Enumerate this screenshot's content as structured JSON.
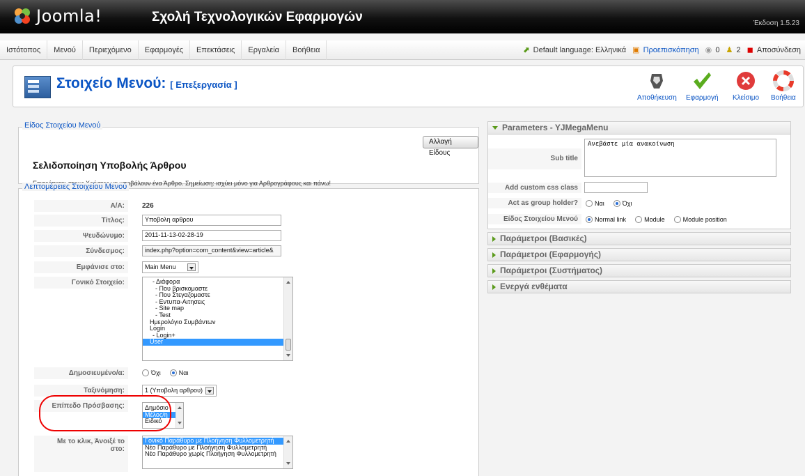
{
  "header": {
    "logo_text": "Joomla!",
    "site_name": "Σχολή Τεχνολογικών Εφαρμογών",
    "version": "Έκδοση 1.5.23"
  },
  "menu": {
    "items": [
      "Ιστότοπος",
      "Μενού",
      "Περιεχόμενο",
      "Εφαρμογές",
      "Επεκτάσεις",
      "Εργαλεία",
      "Βοήθεια"
    ]
  },
  "status": {
    "default_language": "Default language: Ελληνικά",
    "preview": "Προεπισκόπηση",
    "messages": "0",
    "users": "2",
    "logout": "Αποσύνδεση"
  },
  "toolbar": {
    "title": "Στοιχείο Μενού:",
    "subtitle": "[ Επεξεργασία ]",
    "save": "Αποθήκευση",
    "apply": "Εφαρμογή",
    "close": "Κλείσιμο",
    "help": "Βοήθεια"
  },
  "item_type": {
    "legend": "Είδος Στοιχείου Μενού",
    "change_button": "Αλλαγή Είδους",
    "title": "Σελιδοποίηση Υποβολής Άρθρου",
    "description": "Επιτρέπεται στους Χρήστες να υποβάλουν ένα Άρθρο. Σημείωση: ισχύει μόνο για Αρθρογράφους και πάνω!"
  },
  "details": {
    "legend": "Λεπτομέρειες Στοιχείου Μενού",
    "id_label": "Α/Α:",
    "id_value": "226",
    "title_label": "Τίτλος:",
    "title_value": "Υποβολη αρθρου",
    "alias_label": "Ψευδώνυμο:",
    "alias_value": "2011-11-13-02-28-19",
    "link_label": "Σύνδεσμος:",
    "link_value": "index.php?option=com_content&view=article&",
    "display_label": "Εμφάνισε στο:",
    "display_value": "Main Menu",
    "parent_label": "Γονικό Στοιχείο:",
    "parent_items": [
      "- Διάφορα",
      "- Που βρισκομαστε",
      "- Που Στεγαζομαστε",
      "- Εντυπα-Αιτησεις",
      "- Site map",
      "- Test",
      "Ημερολόγιο Συμβάντων",
      "Login",
      "- Login+",
      "User"
    ],
    "parent_selected": "User",
    "published_label": "Δημοσιευμένο/α:",
    "published_no": "Όχι",
    "published_yes": "Ναι",
    "order_label": "Ταξινόμηση:",
    "order_value": "1 (Υποβολη αρθρου)",
    "access_label": "Επίπεδο Πρόσβασης:",
    "access_options": [
      "Δημόσιο",
      "Μέλος/η",
      "Ειδικό"
    ],
    "access_selected": "Μέλος/η",
    "onclick_label_1": "Με το κλικ, Άνοιξέ το",
    "onclick_label_2": "στο:",
    "onclick_options": [
      "Γονικό Παράθυρο με Πλοήγηση Φυλλομετρητή",
      "Νέο Παράθυρο με Πλοήγηση Φυλλομετρητή",
      "Νέο Παράθυρο χωρίς Πλοήγηση Φυλλομετρητή"
    ],
    "onclick_selected": "Γονικό Παράθυρο με Πλοήγηση Φυλλομετρητή"
  },
  "params": {
    "title": "Parameters - YJMegaMenu",
    "subtitle_label": "Sub title",
    "subtitle_value": "Ανεβάστε μία ανακοίνωση",
    "css_label": "Add custom css class",
    "css_value": "",
    "group_label": "Act as group holder?",
    "group_yes": "Ναι",
    "group_no": "Όχι",
    "type_label": "Είδος Στοιχείου Μενού",
    "type_normal": "Normal link",
    "type_module": "Module",
    "type_position": "Module position",
    "collapsed_panels": [
      "Παράμετροι (Βασικές)",
      "Παράμετροι (Εφαρμογής)",
      "Παράμετροι (Συστήματος)",
      "Ενεργά ενθέματα"
    ]
  },
  "colors": {
    "accent": "#0b55c4",
    "selection": "#3399ff",
    "annotation": "#ee0000"
  }
}
